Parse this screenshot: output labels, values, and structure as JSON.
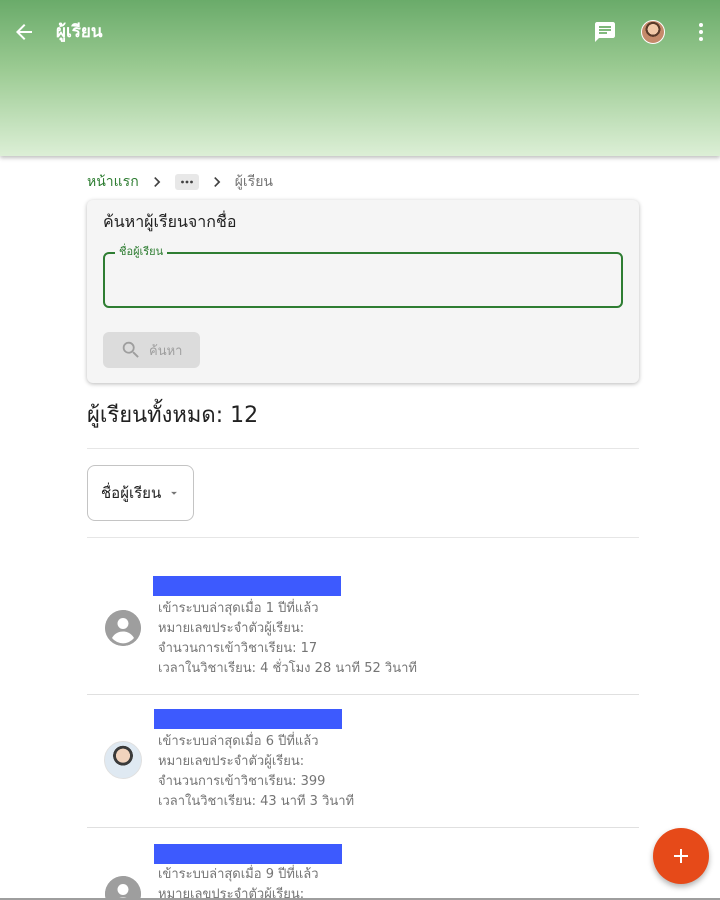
{
  "app_bar": {
    "title": "ผู้เรียน",
    "back_icon": "arrow-back-icon",
    "chat_icon": "chat-icon",
    "profile_icon": "user-avatar",
    "more_icon": "more-vert-icon"
  },
  "breadcrumb": {
    "home": "หน้าแรก",
    "ellipsis": "···",
    "current": "ผู้เรียน"
  },
  "search_card": {
    "heading": "ค้นหาผู้เรียนจากชื่อ",
    "field_label": "ชื่อผู้เรียน",
    "field_value": "",
    "button_label": "ค้นหา"
  },
  "summary": {
    "total_label": "ผู้เรียนทั้งหมด: 12"
  },
  "sort": {
    "label": "ชื่อผู้เรียน"
  },
  "students": [
    {
      "name": "",
      "last_login": "เข้าระบบล่าสุดเมื่อ 1 ปีที่แล้ว",
      "student_id": "หมายเลขประจำตัวผู้เรียน:",
      "course_visits": "จำนวนการเข้าวิชาเรียน: 17",
      "time_in_course": "เวลาในวิชาเรียน: 4 ชั่วโมง 28 นาที 52 วินาที",
      "avatar": "default"
    },
    {
      "name": "",
      "last_login": "เข้าระบบล่าสุดเมื่อ 6 ปีที่แล้ว",
      "student_id": "หมายเลขประจำตัวผู้เรียน:",
      "course_visits": "จำนวนการเข้าวิชาเรียน: 399",
      "time_in_course": "เวลาในวิชาเรียน: 43 นาที 3 วินาที",
      "avatar": "photo"
    },
    {
      "name": "",
      "last_login": "เข้าระบบล่าสุดเมื่อ 9 ปีที่แล้ว",
      "student_id": "หมายเลขประจำตัวผู้เรียน:",
      "avatar": "default"
    }
  ],
  "fab": {
    "icon": "add-icon"
  },
  "colors": {
    "primary_green": "#2e7d32",
    "redaction_blue": "#3d5afe",
    "fab_orange": "#e64a19"
  }
}
